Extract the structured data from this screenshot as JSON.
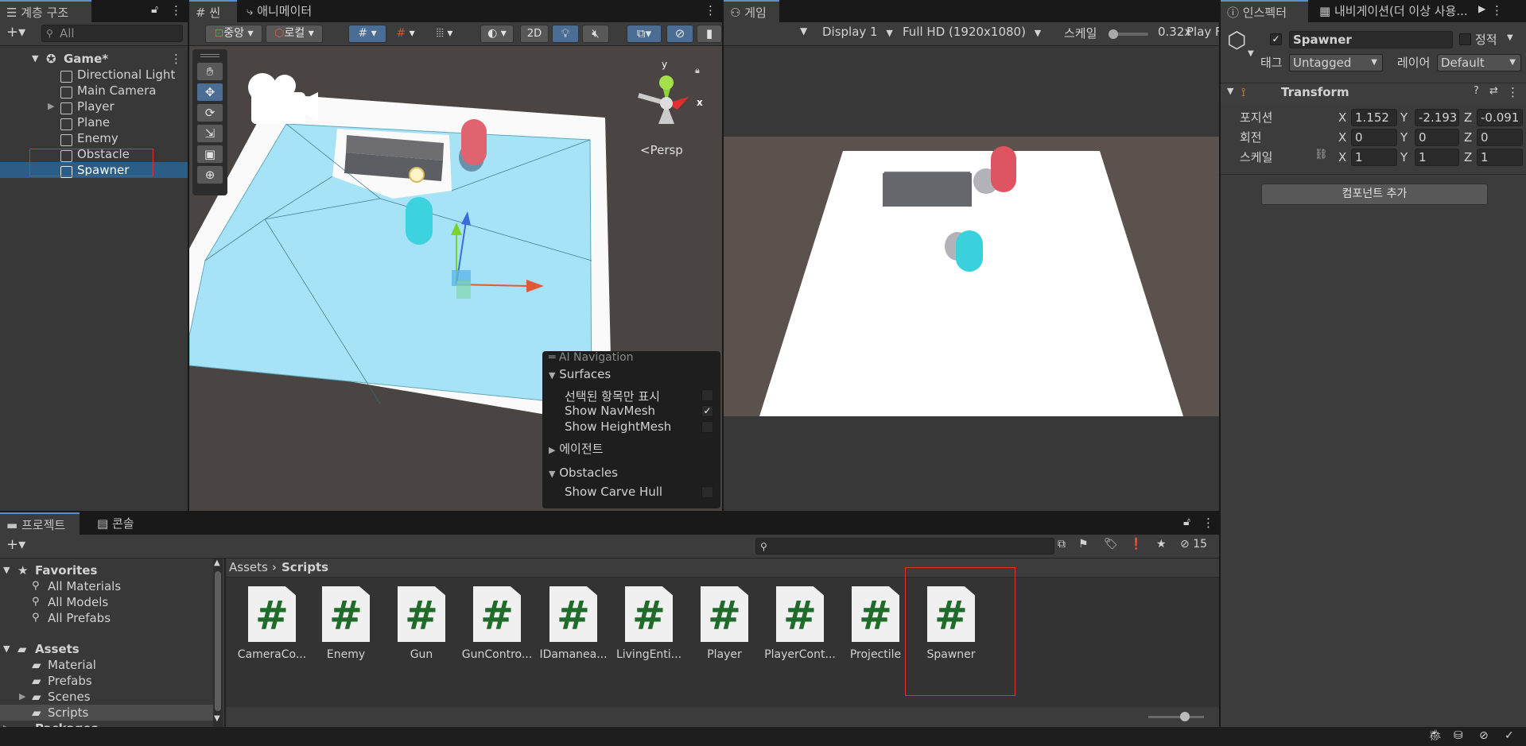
{
  "hierarchy": {
    "tab_label": "계층 구조",
    "search_placeholder": "All",
    "scene_name": "Game*",
    "items": [
      {
        "label": "Directional Light"
      },
      {
        "label": "Main Camera"
      },
      {
        "label": "Player"
      },
      {
        "label": "Plane"
      },
      {
        "label": "Enemy"
      },
      {
        "label": "Obstacle"
      },
      {
        "label": "Spawner"
      }
    ]
  },
  "scene": {
    "tabs": [
      {
        "label": "씬"
      },
      {
        "label": "애니메이터"
      }
    ],
    "pivot_label": "중앙",
    "space_label": "로컬",
    "mode_2d": "2D",
    "persp_label": "Persp",
    "gizmo_y": "y",
    "gizmo_x": "x"
  },
  "ai_nav": {
    "title": "AI Navigation",
    "surfaces_header": "Surfaces",
    "options": [
      {
        "label": "선택된 항목만 표시",
        "checked": false
      },
      {
        "label": "Show NavMesh",
        "checked": true
      },
      {
        "label": "Show HeightMesh",
        "checked": false
      }
    ],
    "agents_header": "에이전트",
    "obstacles_header": "Obstacles",
    "carve_label": "Show Carve Hull",
    "carve_checked": false
  },
  "game": {
    "tab_label": "게임",
    "display": "Display 1",
    "resolution": "Full HD (1920x1080)",
    "scale_label": "스케일",
    "scale_value": "0.32x",
    "play_label": "Play F"
  },
  "inspector": {
    "tabs": [
      {
        "label": "인스펙터"
      },
      {
        "label": "내비게이션(더 이상 사용..."
      }
    ],
    "object_name": "Spawner",
    "static_label": "정적",
    "tag_label": "태그",
    "tag_value": "Untagged",
    "layer_label": "레이어",
    "layer_value": "Default",
    "transform_title": "Transform",
    "rows": [
      {
        "label": "포지션",
        "x": "1.152",
        "y": "-2.193",
        "z": "-0.091"
      },
      {
        "label": "회전",
        "x": "0",
        "y": "0",
        "z": "0"
      },
      {
        "label": "스케일",
        "x": "1",
        "y": "1",
        "z": "1"
      }
    ],
    "axis_x": "X",
    "axis_y": "Y",
    "axis_z": "Z",
    "add_component": "컴포넌트 추가"
  },
  "project": {
    "tabs": [
      {
        "label": "프로젝트"
      },
      {
        "label": "콘솔"
      }
    ],
    "hidden_count": "15",
    "breadcrumb_root": "Assets",
    "breadcrumb_current": "Scripts",
    "tree": {
      "favorites": "Favorites",
      "favorite_items": [
        "All Materials",
        "All Models",
        "All Prefabs"
      ],
      "assets": "Assets",
      "asset_items": [
        "Material",
        "Prefabs",
        "Scenes",
        "Scripts"
      ],
      "packages": "Packages"
    },
    "files": [
      {
        "name": "CameraCo..."
      },
      {
        "name": "Enemy"
      },
      {
        "name": "Gun"
      },
      {
        "name": "GunContro..."
      },
      {
        "name": "IDamanea..."
      },
      {
        "name": "LivingEnti..."
      },
      {
        "name": "Player"
      },
      {
        "name": "PlayerCont..."
      },
      {
        "name": "Projectile"
      },
      {
        "name": "Spawner"
      }
    ],
    "file_glyph": "#"
  },
  "colors": {
    "selection": "#2c5d87",
    "navmesh": "#a6e3f7",
    "highlight_box": "#e0302f",
    "script_hash": "#1f6b2a"
  }
}
